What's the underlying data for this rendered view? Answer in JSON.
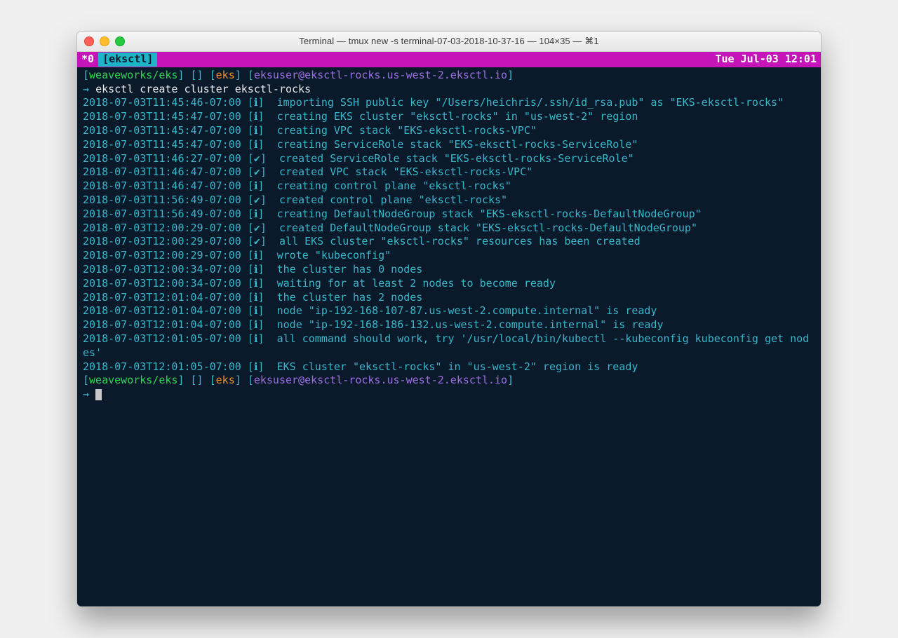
{
  "window": {
    "title": "Terminal — tmux new -s terminal-07-03-2018-10-37-16 — 104×35 — ⌘1"
  },
  "tmux": {
    "left_prefix": "*0",
    "window_name": "[eksctl]",
    "clock": "Tue Jul-03 12:01"
  },
  "prompt": {
    "repo": "weaveworks/eks",
    "eks": "eks",
    "user_host": "eksuser@eksctl-rocks.us-west-2.eksctl.io",
    "arrow": "→"
  },
  "command": "eksctl create cluster eksctl-rocks",
  "logs": [
    {
      "ts": "2018-07-03T11:45:46-07:00",
      "lvl": "ℹ",
      "msg": "importing SSH public key \"/Users/heichris/.ssh/id_rsa.pub\" as \"EKS-eksctl-rocks\""
    },
    {
      "ts": "2018-07-03T11:45:47-07:00",
      "lvl": "ℹ",
      "msg": "creating EKS cluster \"eksctl-rocks\" in \"us-west-2\" region"
    },
    {
      "ts": "2018-07-03T11:45:47-07:00",
      "lvl": "ℹ",
      "msg": "creating VPC stack \"EKS-eksctl-rocks-VPC\""
    },
    {
      "ts": "2018-07-03T11:45:47-07:00",
      "lvl": "ℹ",
      "msg": "creating ServiceRole stack \"EKS-eksctl-rocks-ServiceRole\""
    },
    {
      "ts": "2018-07-03T11:46:27-07:00",
      "lvl": "✔",
      "msg": "created ServiceRole stack \"EKS-eksctl-rocks-ServiceRole\""
    },
    {
      "ts": "2018-07-03T11:46:47-07:00",
      "lvl": "✔",
      "msg": "created VPC stack \"EKS-eksctl-rocks-VPC\""
    },
    {
      "ts": "2018-07-03T11:46:47-07:00",
      "lvl": "ℹ",
      "msg": "creating control plane \"eksctl-rocks\""
    },
    {
      "ts": "2018-07-03T11:56:49-07:00",
      "lvl": "✔",
      "msg": "created control plane \"eksctl-rocks\""
    },
    {
      "ts": "2018-07-03T11:56:49-07:00",
      "lvl": "ℹ",
      "msg": "creating DefaultNodeGroup stack \"EKS-eksctl-rocks-DefaultNodeGroup\""
    },
    {
      "ts": "2018-07-03T12:00:29-07:00",
      "lvl": "✔",
      "msg": "created DefaultNodeGroup stack \"EKS-eksctl-rocks-DefaultNodeGroup\""
    },
    {
      "ts": "2018-07-03T12:00:29-07:00",
      "lvl": "✔",
      "msg": "all EKS cluster \"eksctl-rocks\" resources has been created"
    },
    {
      "ts": "2018-07-03T12:00:29-07:00",
      "lvl": "ℹ",
      "msg": "wrote \"kubeconfig\""
    },
    {
      "ts": "2018-07-03T12:00:34-07:00",
      "lvl": "ℹ",
      "msg": "the cluster has 0 nodes"
    },
    {
      "ts": "2018-07-03T12:00:34-07:00",
      "lvl": "ℹ",
      "msg": "waiting for at least 2 nodes to become ready"
    },
    {
      "ts": "2018-07-03T12:01:04-07:00",
      "lvl": "ℹ",
      "msg": "the cluster has 2 nodes"
    },
    {
      "ts": "2018-07-03T12:01:04-07:00",
      "lvl": "ℹ",
      "msg": "node \"ip-192-168-107-87.us-west-2.compute.internal\" is ready"
    },
    {
      "ts": "2018-07-03T12:01:04-07:00",
      "lvl": "ℹ",
      "msg": "node \"ip-192-168-186-132.us-west-2.compute.internal\" is ready"
    },
    {
      "ts": "2018-07-03T12:01:05-07:00",
      "lvl": "ℹ",
      "msg": "all command should work, try '/usr/local/bin/kubectl --kubeconfig kubeconfig get nodes'"
    },
    {
      "ts": "2018-07-03T12:01:05-07:00",
      "lvl": "ℹ",
      "msg": "EKS cluster \"eksctl-rocks\" in \"us-west-2\" region is ready"
    }
  ]
}
